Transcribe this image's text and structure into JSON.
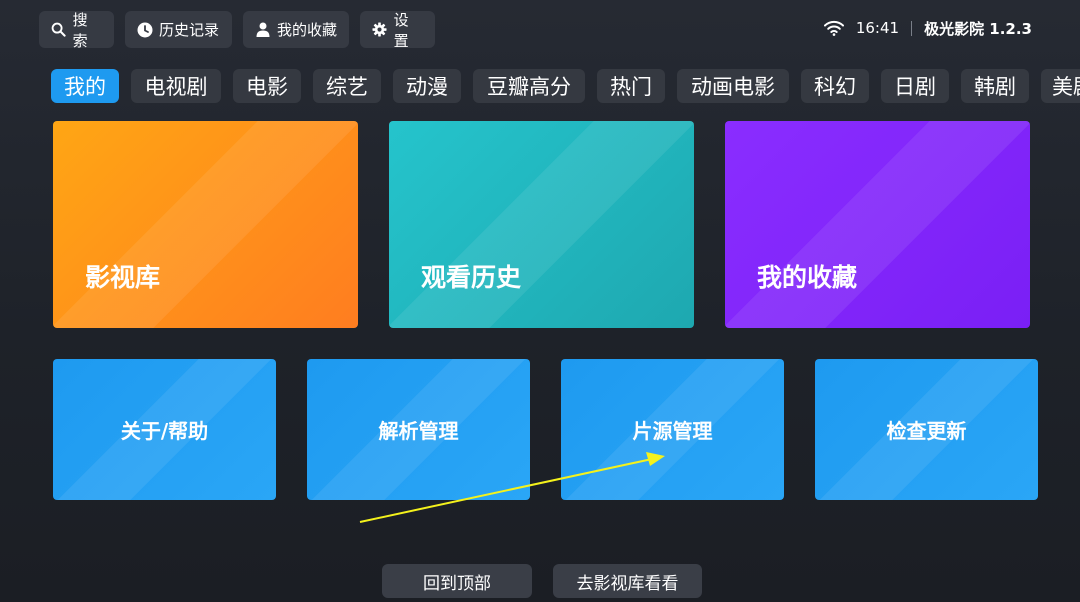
{
  "toolbar": {
    "search": {
      "label": "搜索",
      "icon": "search-icon"
    },
    "history": {
      "label": "历史记录",
      "icon": "clock-icon"
    },
    "favorites": {
      "label": "我的收藏",
      "icon": "user-icon"
    },
    "settings": {
      "label": "设置",
      "icon": "gear-icon"
    }
  },
  "status": {
    "time": "16:41",
    "app_name": "极光影院 1.2.3",
    "wifi_icon": "wifi-icon"
  },
  "tabs": [
    "我的",
    "电视剧",
    "电影",
    "综艺",
    "动漫",
    "豆瓣高分",
    "热门",
    "动画电影",
    "科幻",
    "日剧",
    "韩剧",
    "美剧"
  ],
  "active_tab": "我的",
  "cards_main": [
    {
      "label": "影视库",
      "color_from": "#ffa614",
      "color_to": "#ff7d20"
    },
    {
      "label": "观看历史",
      "color_from": "#25c4cc",
      "color_to": "#1ea8b0"
    },
    {
      "label": "我的收藏",
      "color_from": "#8a2dff",
      "color_to": "#7a1ff5"
    }
  ],
  "cards_tools": [
    {
      "label": "关于/帮助"
    },
    {
      "label": "解析管理"
    },
    {
      "label": "片源管理"
    },
    {
      "label": "检查更新"
    }
  ],
  "tool_color": "#1e9af0",
  "accent": "#1e9af0",
  "annotation_arrow_color": "#f4f21c",
  "bottom": {
    "back_to_top": "回到顶部",
    "go_library": "去影视库看看"
  }
}
